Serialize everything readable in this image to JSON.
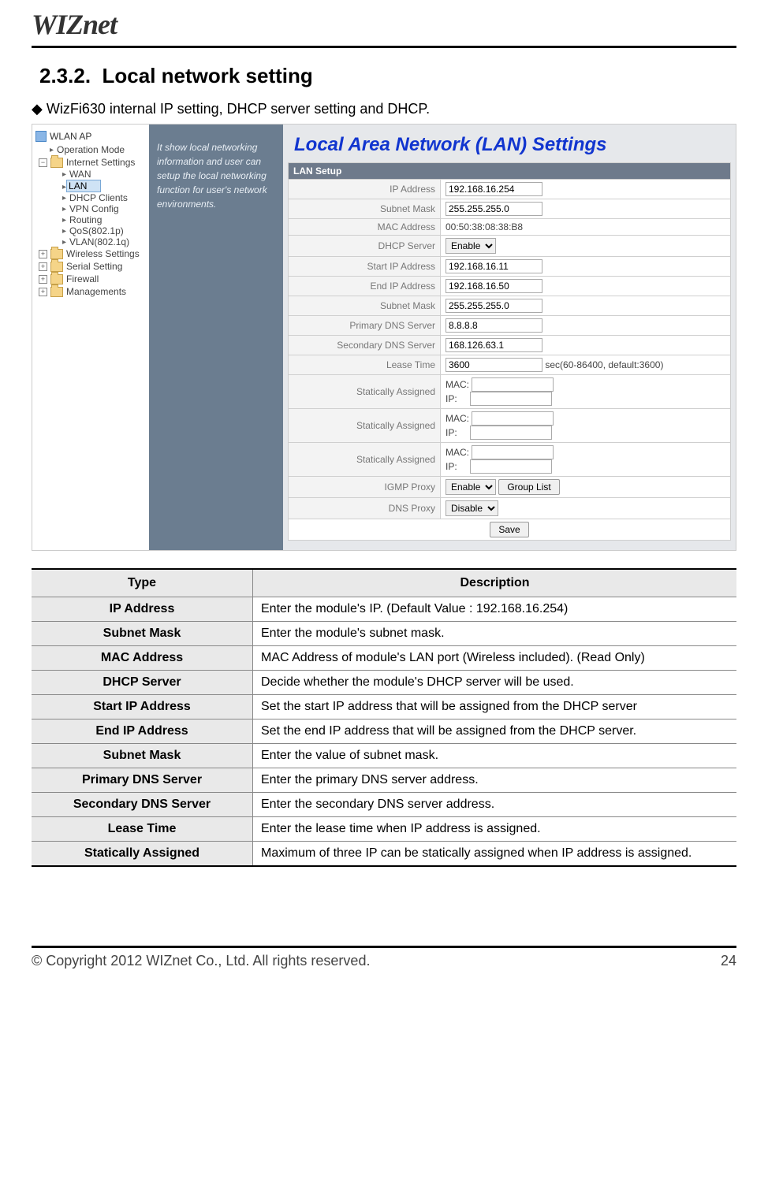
{
  "header": {
    "logo": "WIZnet"
  },
  "section": {
    "number": "2.3.2.",
    "title": "Local network setting"
  },
  "intro": "WizFi630 internal IP setting, DHCP server setting and DHCP.",
  "nav": {
    "root": "WLAN AP",
    "items": [
      "Operation Mode",
      "Internet Settings"
    ],
    "internet_items": [
      "WAN",
      "LAN",
      "DHCP Clients",
      "VPN Config",
      "Routing",
      "QoS(802.1p)",
      "VLAN(802.1q)"
    ],
    "selected": "LAN",
    "folders": [
      "Wireless Settings",
      "Serial Setting",
      "Firewall",
      "Managements"
    ]
  },
  "help_text": "It show local networking information and user can setup the local networking function for user's network environments.",
  "main": {
    "title": "Local Area Network (LAN) Settings",
    "section_label": "LAN Setup",
    "fields": {
      "ip_address": {
        "label": "IP Address",
        "value": "192.168.16.254"
      },
      "subnet_mask": {
        "label": "Subnet Mask",
        "value": "255.255.255.0"
      },
      "mac_address": {
        "label": "MAC Address",
        "value": "00:50:38:08:38:B8"
      },
      "dhcp_server": {
        "label": "DHCP Server",
        "value": "Enable"
      },
      "start_ip": {
        "label": "Start IP Address",
        "value": "192.168.16.11"
      },
      "end_ip": {
        "label": "End IP Address",
        "value": "192.168.16.50"
      },
      "subnet_mask2": {
        "label": "Subnet Mask",
        "value": "255.255.255.0"
      },
      "primary_dns": {
        "label": "Primary DNS Server",
        "value": "8.8.8.8"
      },
      "secondary_dns": {
        "label": "Secondary DNS Server",
        "value": "168.126.63.1"
      },
      "lease_time": {
        "label": "Lease Time",
        "value": "3600",
        "suffix": "sec(60-86400, default:3600)"
      },
      "static1": {
        "label": "Statically Assigned",
        "mac_label": "MAC:",
        "ip_label": "IP:"
      },
      "static2": {
        "label": "Statically Assigned",
        "mac_label": "MAC:",
        "ip_label": "IP:"
      },
      "static3": {
        "label": "Statically Assigned",
        "mac_label": "MAC:",
        "ip_label": "IP:"
      },
      "igmp_proxy": {
        "label": "IGMP Proxy",
        "value": "Enable",
        "btn": "Group List"
      },
      "dns_proxy": {
        "label": "DNS Proxy",
        "value": "Disable"
      }
    },
    "save_btn": "Save"
  },
  "desc_table": {
    "headers": {
      "type": "Type",
      "desc": "Description"
    },
    "rows": [
      {
        "type": "IP Address",
        "desc": "Enter the module's IP. (Default Value : 192.168.16.254)"
      },
      {
        "type": "Subnet Mask",
        "desc": "Enter the module's subnet mask."
      },
      {
        "type": "MAC Address",
        "desc": "MAC Address of module's LAN port (Wireless included). (Read Only)"
      },
      {
        "type": "DHCP Server",
        "desc": "Decide whether the module's DHCP server will be used."
      },
      {
        "type": "Start IP Address",
        "desc": "Set the start IP address that will be assigned from the DHCP server"
      },
      {
        "type": "End IP Address",
        "desc": "Set the end IP address that will be assigned from the DHCP server."
      },
      {
        "type": "Subnet Mask",
        "desc": "Enter the value of subnet mask."
      },
      {
        "type": "Primary DNS Server",
        "desc": "Enter the primary DNS server address."
      },
      {
        "type": "Secondary DNS Server",
        "desc": "Enter the secondary DNS server address."
      },
      {
        "type": "Lease Time",
        "desc": "Enter the lease time when IP address is assigned."
      },
      {
        "type": "Statically Assigned",
        "desc": "Maximum of three IP can be statically assigned when IP address is assigned."
      }
    ]
  },
  "footer": {
    "copyright": "© Copyright 2012 WIZnet Co., Ltd. All rights reserved.",
    "page": "24"
  }
}
